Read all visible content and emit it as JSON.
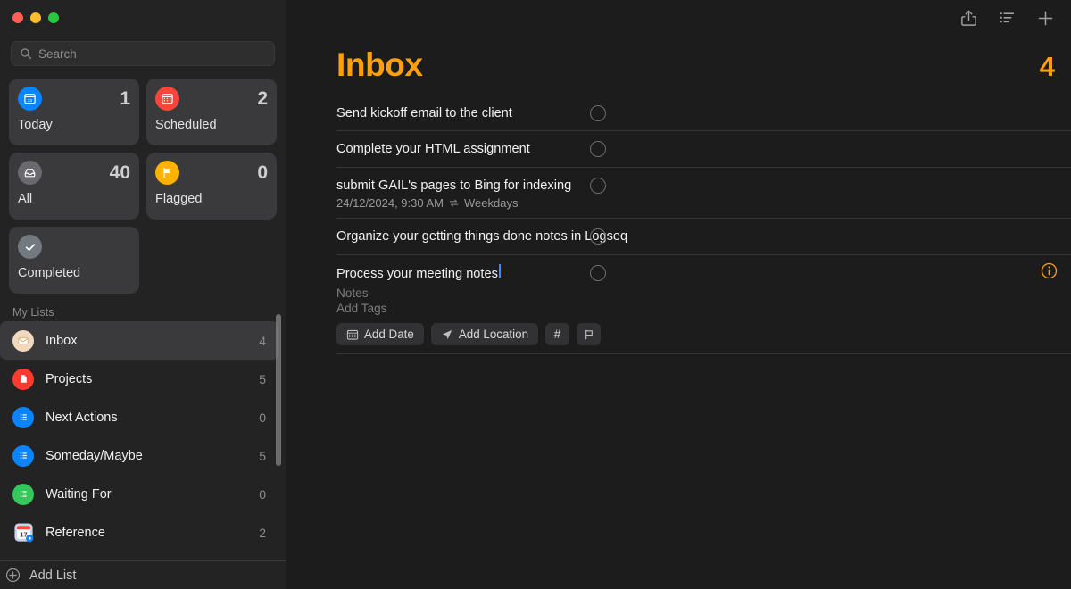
{
  "window": {
    "traffic_lights": [
      {
        "name": "close",
        "color": "#ff5f57"
      },
      {
        "name": "minimize",
        "color": "#febc2e"
      },
      {
        "name": "zoom",
        "color": "#28c840"
      }
    ]
  },
  "sidebar": {
    "search": {
      "placeholder": "Search",
      "value": ""
    },
    "smart_lists": [
      {
        "label": "Today",
        "count": "1",
        "icon": "calendar-day-icon",
        "color": "#0a84ff"
      },
      {
        "label": "Scheduled",
        "count": "2",
        "icon": "calendar-icon",
        "color": "#ff453a"
      },
      {
        "label": "All",
        "count": "40",
        "icon": "tray-icon",
        "color": "#6a6a6e"
      },
      {
        "label": "Flagged",
        "count": "0",
        "icon": "flag-icon",
        "color": "#ffb300"
      },
      {
        "label": "Completed",
        "count": "",
        "icon": "checkmark-icon",
        "color": "#72797f"
      }
    ],
    "my_lists_header": "My Lists",
    "lists": [
      {
        "name": "Inbox",
        "count": "4",
        "icon": "envelope-icon",
        "color": "#f2d9be",
        "selected": true
      },
      {
        "name": "Projects",
        "count": "5",
        "icon": "document-icon",
        "color": "#ff3b30",
        "selected": false
      },
      {
        "name": "Next Actions",
        "count": "0",
        "icon": "bullet-list-icon",
        "color": "#0a84ff",
        "selected": false
      },
      {
        "name": "Someday/Maybe",
        "count": "5",
        "icon": "bullet-list-icon",
        "color": "#0a84ff",
        "selected": false
      },
      {
        "name": "Waiting For",
        "count": "0",
        "icon": "bullet-list-icon",
        "color": "#34c759",
        "selected": false
      },
      {
        "name": "Reference",
        "count": "2",
        "icon": "calendar-app-icon",
        "color": "#c9d4e8",
        "selected": false
      }
    ],
    "add_list_label": "Add List"
  },
  "toolbar": {
    "share_label": "Share",
    "sort_label": "List Options",
    "add_label": "New Reminder"
  },
  "main": {
    "title": "Inbox",
    "title_color": "#ff9f0a",
    "total_count": "4",
    "reminders": [
      {
        "title": "Send kickoff email to the client",
        "meta": "",
        "repeat": "",
        "editing": false
      },
      {
        "title": "Complete your HTML assignment",
        "meta": "",
        "repeat": "",
        "editing": false
      },
      {
        "title": "submit GAIL's pages to Bing for indexing",
        "meta": "24/12/2024, 9:30 AM",
        "repeat": "Weekdays",
        "editing": false
      },
      {
        "title": "Organize your getting things done notes in Logseq",
        "meta": "",
        "repeat": "",
        "editing": false
      },
      {
        "title": "Process your meeting notes",
        "meta": "",
        "repeat": "",
        "editing": true
      }
    ],
    "editor": {
      "notes_placeholder": "Notes",
      "tags_placeholder": "Add Tags",
      "add_date_label": "Add Date",
      "add_location_label": "Add Location",
      "tag_button_label": "#",
      "flag_button_label": "",
      "info_color": "#ff9f0a"
    }
  }
}
